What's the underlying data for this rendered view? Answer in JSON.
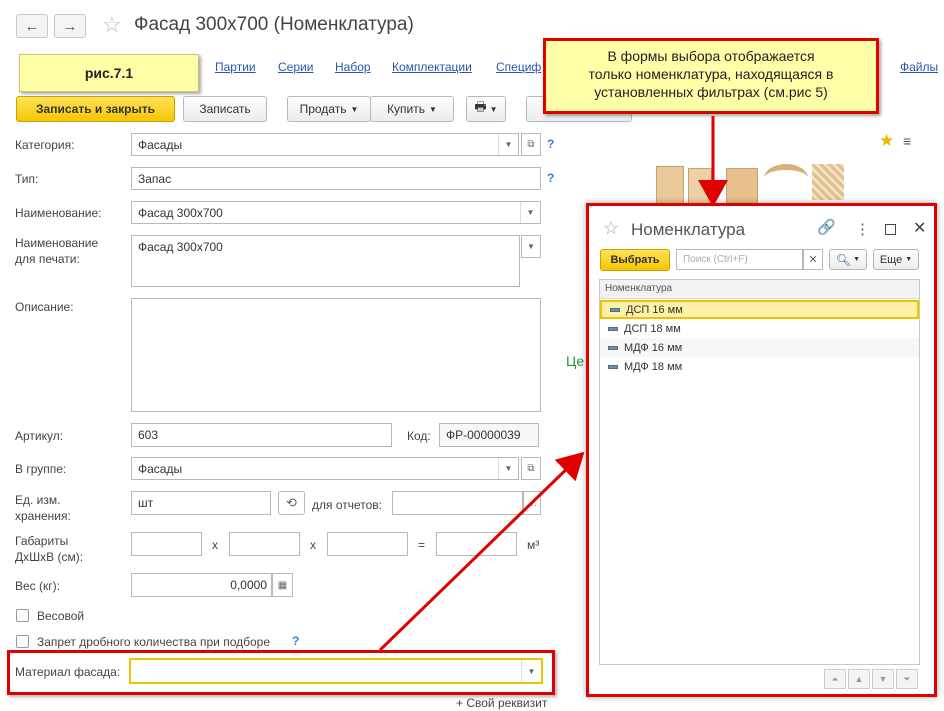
{
  "window": {
    "title": "Фасад 300х700 (Номенклатура)",
    "back_icon": "←",
    "forward_icon": "→"
  },
  "figure_label": "рис.7.1",
  "links": [
    "Партии",
    "Серии",
    "Набор",
    "Комплектации",
    "Специф",
    "Файлы"
  ],
  "toolbar": {
    "save_close": "Записать и закрыть",
    "save": "Записать",
    "sell": "Продать",
    "buy": "Купить"
  },
  "form": {
    "category_label": "Категория:",
    "category_value": "Фасады",
    "type_label": "Тип:",
    "type_value": "Запас",
    "name_label": "Наименование:",
    "name_value": "Фасад 300х700",
    "print_name_label_1": "Наименование",
    "print_name_label_2": "для печати:",
    "print_name_value": "Фасад 300х700",
    "description_label": "Описание:",
    "article_label": "Артикул:",
    "article_value": "603",
    "code_label": "Код:",
    "code_value": "ФР-00000039",
    "group_label": "В группе:",
    "group_value": "Фасады",
    "unit_label_1": "Ед. изм.",
    "unit_label_2": "хранения:",
    "unit_value": "шт",
    "reports_label": "для отчетов:",
    "dims_label_1": "Габариты",
    "dims_label_2": "ДхШхВ (см):",
    "times_sign": "x",
    "equals_sign": "=",
    "m3": "м³",
    "weight_label": "Вес (кг):",
    "weight_value": "0,0000",
    "weighted_label": "Весовой",
    "fractional_label": "Запрет дробного количества при подборе",
    "material_label": "Материал фасада:",
    "material_value": "",
    "own_prop": "+ Свой реквизит",
    "price_fragment": "Це",
    "help": "?"
  },
  "info_callout": {
    "line1": "В формы выбора отображается",
    "line2": "только номенклатура, находящаяся в",
    "line3": "установленных фильтрах  (см.рис 5)"
  },
  "popup": {
    "title": "Номенклатура",
    "select_button": "Выбрать",
    "search_placeholder": "Поиск (Ctrl+F)",
    "more_button": "Еще",
    "column_header": "Номенклатура",
    "rows": [
      "ДСП 16 мм",
      "ДСП 18 мм",
      "МДФ 16 мм",
      "МДФ 18 мм"
    ],
    "selected_index": 0
  },
  "colors": {
    "accent_yellow": "#f6c600",
    "callout_red": "#e00000",
    "link_blue": "#2a55a8",
    "selected_row": "#fdf0a8"
  }
}
